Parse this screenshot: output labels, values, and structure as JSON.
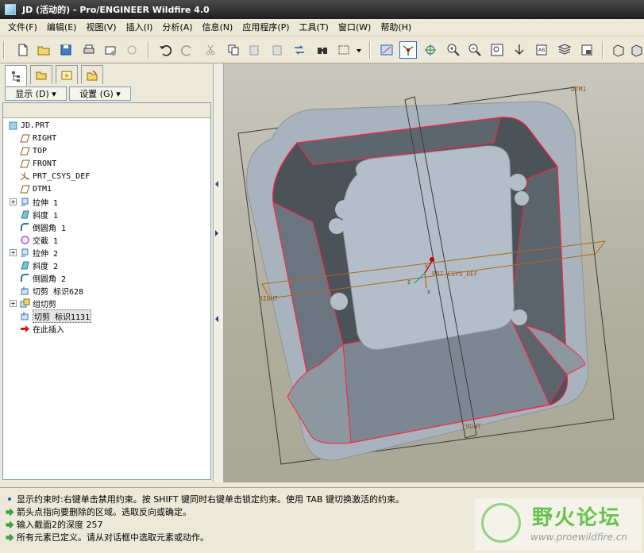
{
  "window": {
    "title": "JD (活动的) - Pro/ENGINEER Wildfire 4.0"
  },
  "menu": [
    "文件(F)",
    "编辑(E)",
    "视图(V)",
    "插入(I)",
    "分析(A)",
    "信息(N)",
    "应用程序(P)",
    "工具(T)",
    "窗口(W)",
    "帮助(H)"
  ],
  "toolbar": {
    "groups": [
      [
        "new-icon",
        "open-icon",
        "save-icon",
        "print-icon",
        "send-icon",
        "disabled-icon"
      ],
      [
        "undo-icon",
        "redo-icon",
        "cut-icon",
        "copy-icon",
        "paste-icon",
        "paste-special-icon",
        "regenerate-icon",
        "find-icon",
        "select-box-icon",
        "select-dropdown-icon"
      ],
      [
        "datum-plane-display-icon",
        "datum-csys-display-icon",
        "spin-center-icon",
        "zoom-in-icon",
        "zoom-out-icon",
        "refit-icon",
        "reorient-icon",
        "saved-views-icon",
        "layers-icon",
        "view-manager-icon"
      ],
      [
        "repaint-icon",
        "shading-icon"
      ]
    ]
  },
  "leftpanel": {
    "display_label": "显示 (D) ▾",
    "settings_label": "设置 (G) ▾",
    "tree": [
      {
        "label": "JD.PRT",
        "icon": "part-icon",
        "indent": 0,
        "expand": ""
      },
      {
        "label": "RIGHT",
        "icon": "datum-plane-icon",
        "indent": 1,
        "expand": ""
      },
      {
        "label": "TOP",
        "icon": "datum-plane-icon",
        "indent": 1,
        "expand": ""
      },
      {
        "label": "FRONT",
        "icon": "datum-plane-icon",
        "indent": 1,
        "expand": ""
      },
      {
        "label": "PRT_CSYS_DEF",
        "icon": "csys-icon",
        "indent": 1,
        "expand": ""
      },
      {
        "label": "DTM1",
        "icon": "datum-plane-icon",
        "indent": 1,
        "expand": ""
      },
      {
        "label": "拉伸 1",
        "icon": "extrude-icon",
        "indent": 1,
        "expand": "+"
      },
      {
        "label": "斜度 1",
        "icon": "draft-icon",
        "indent": 1,
        "expand": ""
      },
      {
        "label": "倒圆角 1",
        "icon": "round-icon",
        "indent": 1,
        "expand": ""
      },
      {
        "label": "交截 1",
        "icon": "intersect-icon",
        "indent": 1,
        "expand": ""
      },
      {
        "label": "拉伸 2",
        "icon": "extrude-icon",
        "indent": 1,
        "expand": "+"
      },
      {
        "label": "斜度 2",
        "icon": "draft-icon",
        "indent": 1,
        "expand": ""
      },
      {
        "label": "倒圆角 2",
        "icon": "round-icon",
        "indent": 1,
        "expand": ""
      },
      {
        "label": "切剪 标识628",
        "icon": "cut-feature-icon",
        "indent": 1,
        "expand": ""
      },
      {
        "label": "组切剪",
        "icon": "group-icon",
        "indent": 1,
        "expand": "+"
      },
      {
        "label": "切剪 标识1131",
        "icon": "cut-feature-icon",
        "indent": 1,
        "expand": "",
        "selected": true
      },
      {
        "label": "在此插入",
        "icon": "insert-here-icon",
        "indent": 1,
        "expand": ""
      }
    ]
  },
  "viewport": {
    "datum_labels": {
      "dtm1": "DTM1",
      "right": "RIGHT",
      "front": "FRONT",
      "csys": "PRT_CSYS_DEF",
      "axis_x": "X",
      "axis_y": "Y",
      "axis_z": "Z"
    }
  },
  "messages": [
    {
      "icon": "info-dot-icon",
      "text": "显示约束时:右键单击禁用约束。按 SHIFT 键同时右键单击锁定约束。使用 TAB 键切换激活的约束。"
    },
    {
      "icon": "prompt-arrow-icon",
      "text": "箭头点指向要删除的区域。选取反向或确定。"
    },
    {
      "icon": "prompt-arrow-icon",
      "text": "输入截面2的深度  257"
    },
    {
      "icon": "prompt-arrow-icon",
      "text": "所有元素已定义。请从对话框中选取元素或动作。"
    }
  ],
  "watermark": {
    "cn": "野火论坛",
    "url": "www.proewildfire.cn"
  }
}
